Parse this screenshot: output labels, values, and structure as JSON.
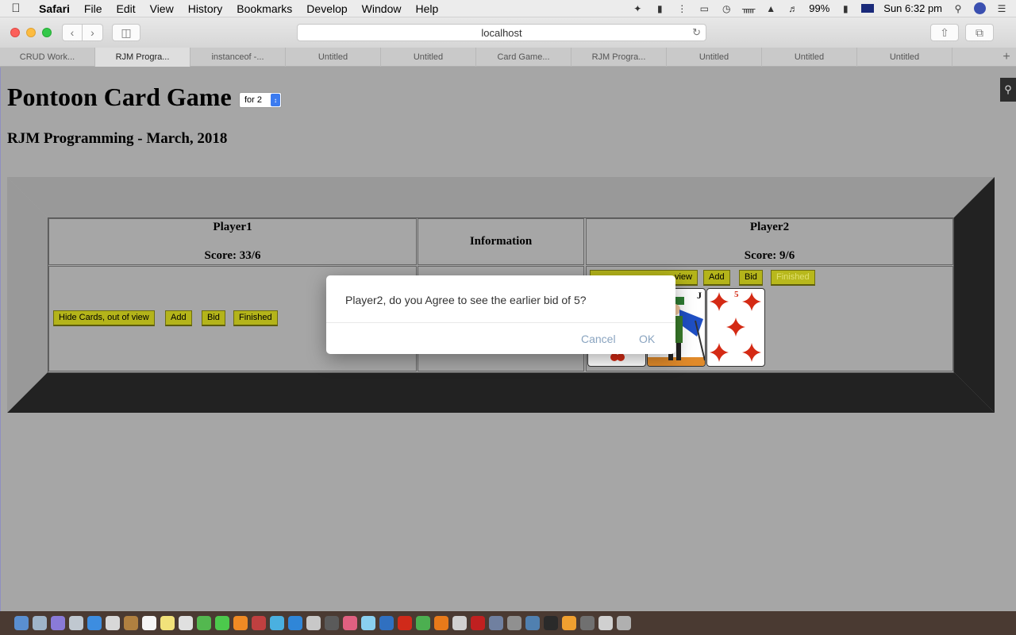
{
  "menubar": {
    "app": "Safari",
    "items": [
      "File",
      "Edit",
      "View",
      "History",
      "Bookmarks",
      "Develop",
      "Window",
      "Help"
    ],
    "battery": "99%",
    "clock": "Sun 6:32 pm"
  },
  "toolbar": {
    "address": "localhost"
  },
  "tabs": [
    {
      "label": "CRUD Work..."
    },
    {
      "label": "RJM Progra..."
    },
    {
      "label": "instanceof -..."
    },
    {
      "label": "Untitled"
    },
    {
      "label": "Untitled"
    },
    {
      "label": "Card Game..."
    },
    {
      "label": "RJM Progra..."
    },
    {
      "label": "Untitled"
    },
    {
      "label": "Untitled"
    },
    {
      "label": "Untitled"
    }
  ],
  "page": {
    "title": "Pontoon Card Game",
    "select_value": "for 2",
    "subtitle": "RJM Programming - March, 2018"
  },
  "game": {
    "player1": {
      "name": "Player1",
      "score": "Score: 33/6"
    },
    "info_header": "Information",
    "player2": {
      "name": "Player2",
      "score": "Score: 9/6"
    },
    "buttons": {
      "hide": "Hide Cards, out of view",
      "hide_partial": "view",
      "add": "Add",
      "bid": "Bid",
      "finished": "Finished"
    },
    "cards": {
      "jack_rank": "J",
      "five_rank": "5"
    }
  },
  "dialog": {
    "message": "Player2, do you Agree to see the earlier bid of 5?",
    "cancel": "Cancel",
    "ok": "OK"
  },
  "colors": {
    "felt_gray": "#a6a6a6",
    "button_olive": "#b4b41a",
    "card_red": "#d42a14",
    "dialog_button": "#8aa4c0"
  }
}
